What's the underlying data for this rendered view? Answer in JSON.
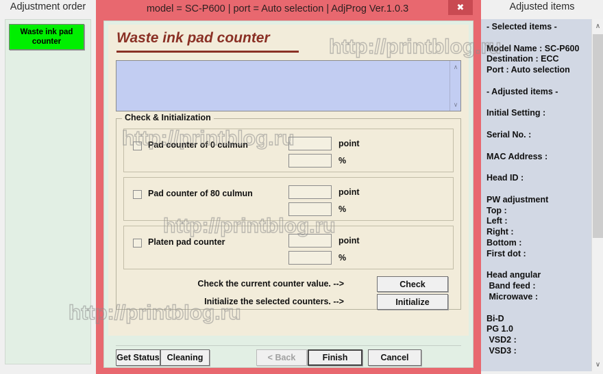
{
  "left": {
    "title": "Adjustment order",
    "button_label": "Waste ink pad counter"
  },
  "dialog": {
    "titlebar": "model = SC-P600 | port = Auto selection | AdjProg Ver.1.0.3",
    "close_icon": "✖",
    "heading": "Waste ink pad counter",
    "log_value": "",
    "scroll_up_icon": "∧",
    "scroll_down_icon": "∨",
    "group": {
      "legend": "Check & Initialization",
      "rows": [
        {
          "label": "Pad counter of  0 culmun",
          "point_value": "",
          "point_unit": "point",
          "percent_value": "",
          "percent_unit": "%",
          "checked": false
        },
        {
          "label": "Pad counter of 80 culmun",
          "point_value": "",
          "point_unit": "point",
          "percent_value": "",
          "percent_unit": "%",
          "checked": false
        },
        {
          "label": "Platen pad counter",
          "point_value": "",
          "point_unit": "point",
          "percent_value": "",
          "percent_unit": "%",
          "checked": false
        }
      ],
      "actions": [
        {
          "text": "Check the current counter value. -->",
          "button": "Check"
        },
        {
          "text": "Initialize the selected counters. -->",
          "button": "Initialize"
        }
      ]
    },
    "nav": {
      "get_status": "Get Status",
      "cleaning": "Cleaning",
      "back": "< Back",
      "finish": "Finish",
      "cancel": "Cancel"
    }
  },
  "right": {
    "title": "Adjusted items",
    "body": "- Selected items -\n\nModel Name : SC-P600\nDestination : ECC\nPort : Auto selection\n\n- Adjusted items -\n\nInitial Setting :\n\nSerial No. :\n\nMAC Address :\n\nHead ID :\n\nPW adjustment\nTop :\nLeft :\nRight :\nBottom :\nFirst dot :\n\nHead angular\n Band feed :\n Microwave :\n\nBi-D\nPG 1.0\n VSD2 :\n VSD3 :",
    "scroll_up_icon": "∧",
    "scroll_down_icon": "∨"
  },
  "watermark": {
    "text": "http://printblog.ru"
  },
  "colors": {
    "frame_red": "#e8686f",
    "accent_heading": "#8a3025",
    "selected_button_green": "#00ef00",
    "panel_cream": "#f2ecda",
    "panel_green": "#e2efe4",
    "right_panel_blue": "#d2d8e4",
    "log_blue": "#c2cdf2"
  }
}
